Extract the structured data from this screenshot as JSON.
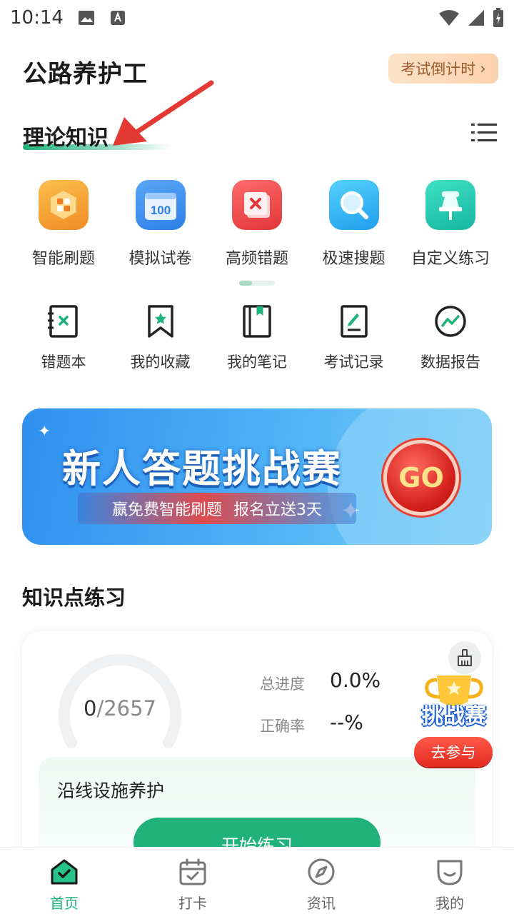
{
  "status_bar": {
    "time": "10:14"
  },
  "header": {
    "title": "公路养护工",
    "countdown_label": "考试倒计时"
  },
  "section": {
    "active_tab": "理论知识"
  },
  "features_row1": [
    {
      "label": "智能刷题",
      "icon": "smart-practice-icon",
      "color": "#f7a53a"
    },
    {
      "label": "模拟试卷",
      "icon": "mock-exam-icon",
      "color": "#3b8ff0"
    },
    {
      "label": "高频错题",
      "icon": "frequent-mistakes-icon",
      "color": "#f14a4a"
    },
    {
      "label": "极速搜题",
      "icon": "quick-search-icon",
      "color": "#2fb8f0"
    },
    {
      "label": "自定义练习",
      "icon": "custom-practice-icon",
      "color": "#26c7b0"
    }
  ],
  "features_row2": [
    {
      "label": "错题本",
      "icon": "mistake-book-icon"
    },
    {
      "label": "我的收藏",
      "icon": "bookmark-icon"
    },
    {
      "label": "我的笔记",
      "icon": "notes-icon"
    },
    {
      "label": "考试记录",
      "icon": "exam-record-icon"
    },
    {
      "label": "数据报告",
      "icon": "data-report-icon"
    }
  ],
  "banner": {
    "title": "新人答题挑战赛",
    "subtitle_left": "赢免费智能刷题",
    "subtitle_right": "报名立送3天",
    "go": "GO"
  },
  "knowledge": {
    "title": "知识点练习",
    "done": "0",
    "total": "/2657",
    "progress_label": "总进度",
    "progress_value": "0.0%",
    "accuracy_label": "正确率",
    "accuracy_value": "--%",
    "chapter": "沿线设施养护",
    "start_button": "开始练习"
  },
  "challenge_float": {
    "title": "挑战赛",
    "button": "去参与"
  },
  "bottom_nav": [
    {
      "label": "首页",
      "icon": "home-icon",
      "active": true
    },
    {
      "label": "打卡",
      "icon": "calendar-check-icon",
      "active": false
    },
    {
      "label": "资讯",
      "icon": "compass-icon",
      "active": false
    },
    {
      "label": "我的",
      "icon": "profile-icon",
      "active": false
    }
  ],
  "accent_color": "#1fb27a"
}
